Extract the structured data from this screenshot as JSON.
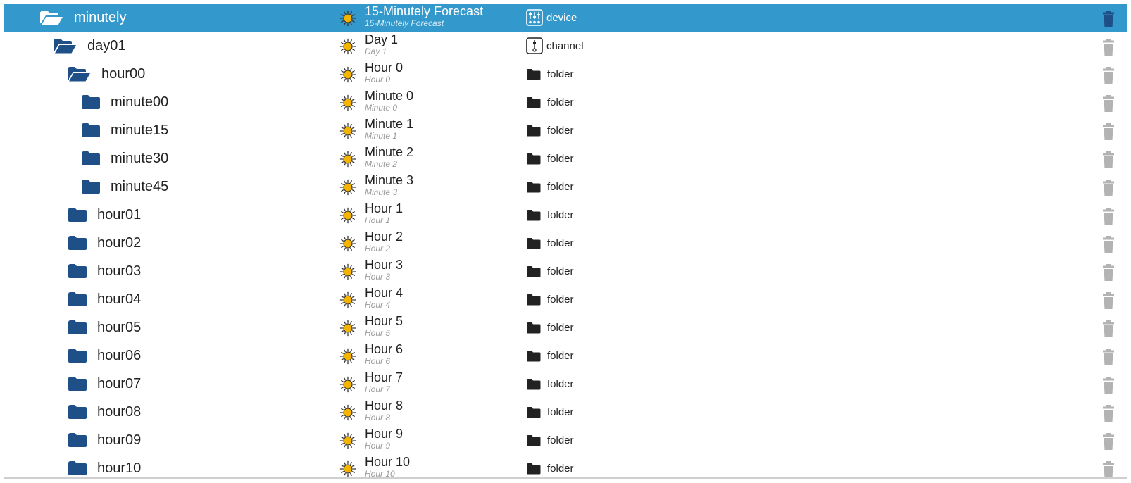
{
  "colors": {
    "selected_row": "#3399cc",
    "folder_icon": "#1f4f87",
    "sun_fill": "#f5b400",
    "type_icon": "#222222",
    "delete_active": "#1f4f87",
    "delete_inactive": "#b3b3b3"
  },
  "rows": [
    {
      "name": "minutely",
      "title": "15-Minutely Forecast",
      "subtitle": "15-Minutely Forecast",
      "type": "device",
      "type_icon": "device-icon",
      "folder_icon": "folder-open-icon",
      "level": 0,
      "selected": true
    },
    {
      "name": "day01",
      "title": "Day 1",
      "subtitle": "Day 1",
      "type": "channel",
      "type_icon": "channel-icon",
      "folder_icon": "folder-open-icon",
      "level": 1,
      "selected": false
    },
    {
      "name": "hour00",
      "title": "Hour 0",
      "subtitle": "Hour 0",
      "type": "folder",
      "type_icon": "folder-icon",
      "folder_icon": "folder-open-icon",
      "level": 2,
      "selected": false
    },
    {
      "name": "minute00",
      "title": "Minute 0",
      "subtitle": "Minute 0",
      "type": "folder",
      "type_icon": "folder-icon",
      "folder_icon": "folder-icon",
      "level": 3,
      "selected": false
    },
    {
      "name": "minute15",
      "title": "Minute 1",
      "subtitle": "Minute 1",
      "type": "folder",
      "type_icon": "folder-icon",
      "folder_icon": "folder-icon",
      "level": 3,
      "selected": false
    },
    {
      "name": "minute30",
      "title": "Minute 2",
      "subtitle": "Minute 2",
      "type": "folder",
      "type_icon": "folder-icon",
      "folder_icon": "folder-icon",
      "level": 3,
      "selected": false
    },
    {
      "name": "minute45",
      "title": "Minute 3",
      "subtitle": "Minute 3",
      "type": "folder",
      "type_icon": "folder-icon",
      "folder_icon": "folder-icon",
      "level": 3,
      "selected": false
    },
    {
      "name": "hour01",
      "title": "Hour 1",
      "subtitle": "Hour 1",
      "type": "folder",
      "type_icon": "folder-icon",
      "folder_icon": "folder-icon",
      "level": 2,
      "selected": false
    },
    {
      "name": "hour02",
      "title": "Hour 2",
      "subtitle": "Hour 2",
      "type": "folder",
      "type_icon": "folder-icon",
      "folder_icon": "folder-icon",
      "level": 2,
      "selected": false
    },
    {
      "name": "hour03",
      "title": "Hour 3",
      "subtitle": "Hour 3",
      "type": "folder",
      "type_icon": "folder-icon",
      "folder_icon": "folder-icon",
      "level": 2,
      "selected": false
    },
    {
      "name": "hour04",
      "title": "Hour 4",
      "subtitle": "Hour 4",
      "type": "folder",
      "type_icon": "folder-icon",
      "folder_icon": "folder-icon",
      "level": 2,
      "selected": false
    },
    {
      "name": "hour05",
      "title": "Hour 5",
      "subtitle": "Hour 5",
      "type": "folder",
      "type_icon": "folder-icon",
      "folder_icon": "folder-icon",
      "level": 2,
      "selected": false
    },
    {
      "name": "hour06",
      "title": "Hour 6",
      "subtitle": "Hour 6",
      "type": "folder",
      "type_icon": "folder-icon",
      "folder_icon": "folder-icon",
      "level": 2,
      "selected": false
    },
    {
      "name": "hour07",
      "title": "Hour 7",
      "subtitle": "Hour 7",
      "type": "folder",
      "type_icon": "folder-icon",
      "folder_icon": "folder-icon",
      "level": 2,
      "selected": false
    },
    {
      "name": "hour08",
      "title": "Hour 8",
      "subtitle": "Hour 8",
      "type": "folder",
      "type_icon": "folder-icon",
      "folder_icon": "folder-icon",
      "level": 2,
      "selected": false
    },
    {
      "name": "hour09",
      "title": "Hour 9",
      "subtitle": "Hour 9",
      "type": "folder",
      "type_icon": "folder-icon",
      "folder_icon": "folder-icon",
      "level": 2,
      "selected": false
    },
    {
      "name": "hour10",
      "title": "Hour 10",
      "subtitle": "Hour 10",
      "type": "folder",
      "type_icon": "folder-icon",
      "folder_icon": "folder-icon",
      "level": 2,
      "selected": false
    }
  ]
}
